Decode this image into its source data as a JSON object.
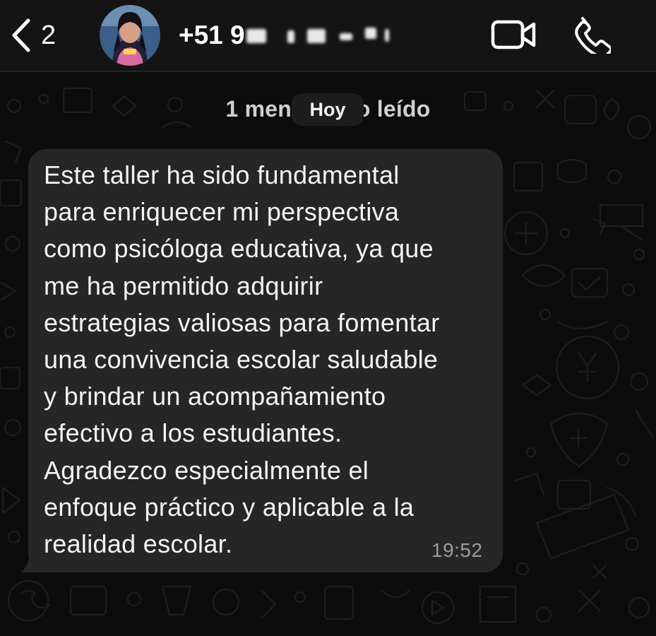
{
  "header": {
    "back_count": "2",
    "contact_name_visible": "+51 9",
    "avatar_label": "contact photo"
  },
  "chat": {
    "unread_text": "1 mensaje no leído",
    "date_chip": "Hoy"
  },
  "message": {
    "lines": [
      "Este taller ha sido fundamental",
      "para enriquecer mi perspectiva",
      "como psicóloga educativa, ya que",
      "me ha permitido adquirir",
      "estrategias valiosas para fomentar",
      "una convivencia escolar saludable",
      "y brindar un acompañamiento",
      "efectivo a los estudiantes.",
      "Agradezco especialmente el",
      "enfoque práctico y aplicable a la",
      "realidad escolar."
    ],
    "time": "19:52"
  },
  "icons": {
    "back": "chevron-left-icon",
    "video": "video-camera-icon",
    "call": "phone-icon"
  },
  "colors": {
    "background": "#0c0c0c",
    "header": "#141414",
    "bubble": "#262626",
    "text": "#f4f4f4",
    "timestamp": "#9c9c9c"
  }
}
